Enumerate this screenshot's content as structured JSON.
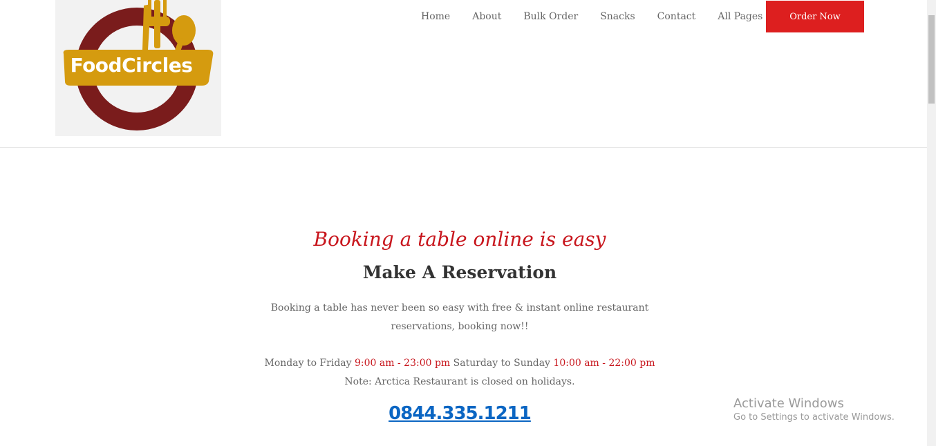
{
  "logo": {
    "text": "FoodCircles",
    "colors": {
      "ring": "#7a1c1c",
      "banner": "#d59b0f",
      "text": "#ffffff"
    }
  },
  "nav": {
    "items": [
      {
        "label": "Home"
      },
      {
        "label": "About"
      },
      {
        "label": "Bulk Order"
      },
      {
        "label": "Snacks"
      },
      {
        "label": "Contact"
      },
      {
        "label": "All Pages"
      }
    ],
    "order_button": "Order Now"
  },
  "reservation": {
    "script_title": "Booking a table online is easy",
    "title": "Make A Reservation",
    "description": "Booking a table has never been so easy with free & instant online restaurant reservations, booking now!!",
    "weekday_label": "Monday to Friday",
    "weekday_hours": "9:00 am - 23:00 pm",
    "weekend_label": "Saturday to Sunday",
    "weekend_hours": "10:00 am - 22:00 pm",
    "note": "Note: Arctica Restaurant is closed on holidays.",
    "phone": "0844.335.1211"
  },
  "windows_watermark": {
    "line1": "Activate Windows",
    "line2": "Go to Settings to activate Windows."
  },
  "colors": {
    "accent_red": "#dd1f1f",
    "link_blue": "#0b66c3"
  }
}
